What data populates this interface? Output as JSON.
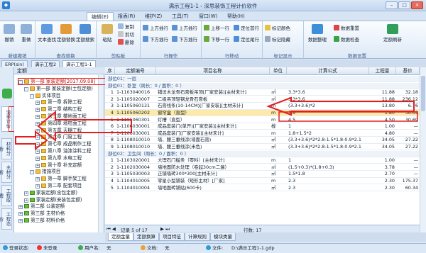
{
  "app": {
    "title": "满示工程1-1 - 深思装饰工程计价软件"
  },
  "menu": [
    "编辑(E)",
    "报表(R)",
    "维护(Z)",
    "工具(T)",
    "窗口(W)",
    "帮助(H)"
  ],
  "ribbon": {
    "groups": [
      {
        "label": "新建撤销",
        "buttons": [
          "撤销",
          "重做"
        ]
      },
      {
        "label": "查找替换",
        "buttons": [
          "文本查找",
          "定额替换",
          "定额搜索"
        ]
      },
      {
        "label": "剪贴板",
        "buttons": [
          "粘贴"
        ],
        "small": [
          "复制",
          "剪切",
          "删除"
        ]
      },
      {
        "label": "行操作",
        "small": [
          "上方插行",
          "下方插行",
          "上方插行",
          "下方插行"
        ]
      },
      {
        "label": "行移动",
        "small": [
          "上移一行",
          "下移一行",
          "定位首行",
          "定位尾行"
        ]
      },
      {
        "label": "标记显示",
        "small": [
          "标记颜色",
          "标记隐藏"
        ]
      },
      {
        "label": "数据设置",
        "buttons": [
          "数据整理",
          "数据检查",
          "定额刷新"
        ],
        "small": [
          "数据重置"
        ]
      }
    ]
  },
  "doc_tabs": [
    "ERP(sin)",
    "满示工程2",
    "满示工程1-1"
  ],
  "sidebar_tabs": [
    "清单计价",
    "材料分析",
    "主材分析",
    "工程取费",
    "工程造价"
  ],
  "tree": {
    "header": "定额",
    "nodes": [
      {
        "text": "第一部 家装定额[2017.09.08]",
        "level": 0,
        "sel": true,
        "toggle": "-"
      },
      {
        "text": "第一部 家装定额(土包定额)",
        "level": 1,
        "toggle": "-"
      },
      {
        "text": "实体项目",
        "level": 2,
        "toggle": "-"
      },
      {
        "text": "第一章 拆除工程",
        "level": 3,
        "toggle": "+"
      },
      {
        "text": "第二章 结构工程",
        "level": 3,
        "toggle": "+"
      },
      {
        "text": "第三章 楼地面工程",
        "level": 3,
        "toggle": "+"
      },
      {
        "text": "第四章 墙柱面工程",
        "level": 3,
        "toggle": "+"
      },
      {
        "text": "第五章 天棚工程",
        "level": 3,
        "toggle": "+"
      },
      {
        "text": "第六章 门窗工程",
        "level": 3,
        "toggle": "+"
      },
      {
        "text": "第七章 成品制作工程",
        "level": 3,
        "toggle": "+"
      },
      {
        "text": "第八章 油漆涂料工程",
        "level": 3,
        "toggle": "+"
      },
      {
        "text": "第九章 水电工程",
        "level": 3,
        "toggle": "+"
      },
      {
        "text": "第十章 补充定额",
        "level": 3,
        "toggle": "+"
      },
      {
        "text": "措施项目",
        "level": 2,
        "toggle": "-"
      },
      {
        "text": "第一章 脚手架工程",
        "level": 3,
        "toggle": "+"
      },
      {
        "text": "第二章 配套项目",
        "level": 3,
        "toggle": "+"
      },
      {
        "text": "家装定额(含包定额)",
        "level": 1,
        "toggle": "+",
        "green": true
      },
      {
        "text": "家装定额(安装包定额)",
        "level": 1,
        "toggle": "+",
        "green": true
      },
      {
        "text": "第二部 公装定额",
        "level": 0,
        "toggle": "+",
        "green": true
      },
      {
        "text": "第三部 主材价格",
        "level": 0,
        "toggle": "+",
        "green": true
      },
      {
        "text": "第三部 材料价格",
        "level": 0,
        "toggle": "+",
        "green": true
      }
    ]
  },
  "grid": {
    "headers": [
      "序",
      "定额编号",
      "项目名称",
      "单位",
      "计算公式",
      "工程量",
      "基价"
    ],
    "rows": [
      {
        "type": "group",
        "text": "部位01：一层"
      },
      {
        "type": "group",
        "text": "部位01：卧室（周长：0 / 面积：0 ）"
      },
      {
        "n": "1",
        "code": "1-1103040016",
        "name": "铺设木龙骨石膏板吊顶[厂家安装][主材未计]",
        "unit": "㎡",
        "formula": "3.3*3.6",
        "qty": "11.88",
        "price": "32.18"
      },
      {
        "n": "2",
        "code": "1-1105020007",
        "name": "二级吊顶轻钢龙骨石膏板",
        "unit": "㎡",
        "formula": "3.3*3.6",
        "qty": "11.88",
        "price": "236.12"
      },
      {
        "n": "3",
        "code": "1-1105060131",
        "name": "石膏线条(10-14CM)[厂家安装][主材未计]",
        "unit": "m",
        "formula": "(3.3+3.6)*2",
        "qty": "13.80",
        "price": "6.76"
      },
      {
        "n": "4",
        "code": "1-1105060202",
        "name": "窗帘盒（直型）",
        "unit": "m",
        "formula": "1.8",
        "qty": "1.80",
        "price": "36.69",
        "hl": true
      },
      {
        "n": "5",
        "code": "1-1105060301",
        "name": "灯槽（直型）",
        "unit": "m",
        "formula": "4.5",
        "qty": "4.50",
        "price": "30.69"
      },
      {
        "n": "6",
        "code": "1-1106030001",
        "name": "成品套装门(单开)[厂家安装][主材未计]",
        "unit": "樘",
        "formula": "1",
        "qty": "1.00",
        "price": "—"
      },
      {
        "n": "7",
        "code": "1-1106030001",
        "name": "成品套装门[厂家安装][主材未计]",
        "unit": "m",
        "formula": "1.8+1.5*2",
        "qty": "4.80",
        "price": "—"
      },
      {
        "n": "8",
        "code": "1-1108010010",
        "name": "墙、腰三垂线涂(墙面石膏)",
        "unit": "㎡",
        "formula": "(3.3+3.6)*2*2.8-1.5*1.8-0.9*2.1",
        "qty": "34.05",
        "price": "27.22"
      },
      {
        "n": "9",
        "code": "1-1108010010",
        "name": "墙、腰三垂线涂(米色)",
        "unit": "㎡",
        "formula": "(3.3+3.6)*2*2.8-1.5*1.8-0.9*2.1",
        "qty": "34.05",
        "price": "27.22"
      },
      {
        "type": "group",
        "text": "部位02：卫生间（周长：0 / 面积：0 ）"
      },
      {
        "n": "1",
        "code": "1-1103020001",
        "name": "大理石门槛条（零料）[主材未计]",
        "unit": "m",
        "formula": "1",
        "qty": "1.00",
        "price": "—"
      },
      {
        "n": "2",
        "code": "1-1102030004",
        "name": "墙地面防水处理（卷起30cm二遍）",
        "unit": "㎡",
        "formula": "(1.5+0.3)*(1.8+0.3)",
        "qty": "3.78",
        "price": "—"
      },
      {
        "n": "3",
        "code": "1-1105030003",
        "name": "正铺墙砖300*300[主材未计]",
        "unit": "㎡",
        "formula": "1.5*1.8",
        "qty": "2.70",
        "price": "—"
      },
      {
        "n": "4",
        "code": "1-1104010005",
        "name": "零星小型铺装（矩形主材）[厂家]",
        "unit": "m",
        "formula": "2.3",
        "qty": "2.30",
        "price": "175.37"
      },
      {
        "n": "5",
        "code": "1-1104010004",
        "name": "墙地面砖铺贴(600卡)",
        "unit": "㎡",
        "formula": "2.3",
        "qty": "2.30",
        "price": "60.34"
      }
    ]
  },
  "pager": {
    "total_label": "行数: 17",
    "page": "记录 5 of 17"
  },
  "bottom_tabs": [
    "定额金量",
    "定额换算",
    "项目特征",
    "计算规则",
    "模块类量"
  ],
  "status": {
    "login": "登录状态:",
    "login_val": "未登录",
    "user": "用户名:",
    "user_val": "无",
    "doc": "文档:",
    "doc_val": "无",
    "file": "文件:",
    "file_val": "D:\\满示工程1-1.gdp"
  },
  "colors": {
    "accent_red": "#e02020",
    "highlight": "#fde9a8",
    "ribbon_bg": "#dde9f7"
  }
}
